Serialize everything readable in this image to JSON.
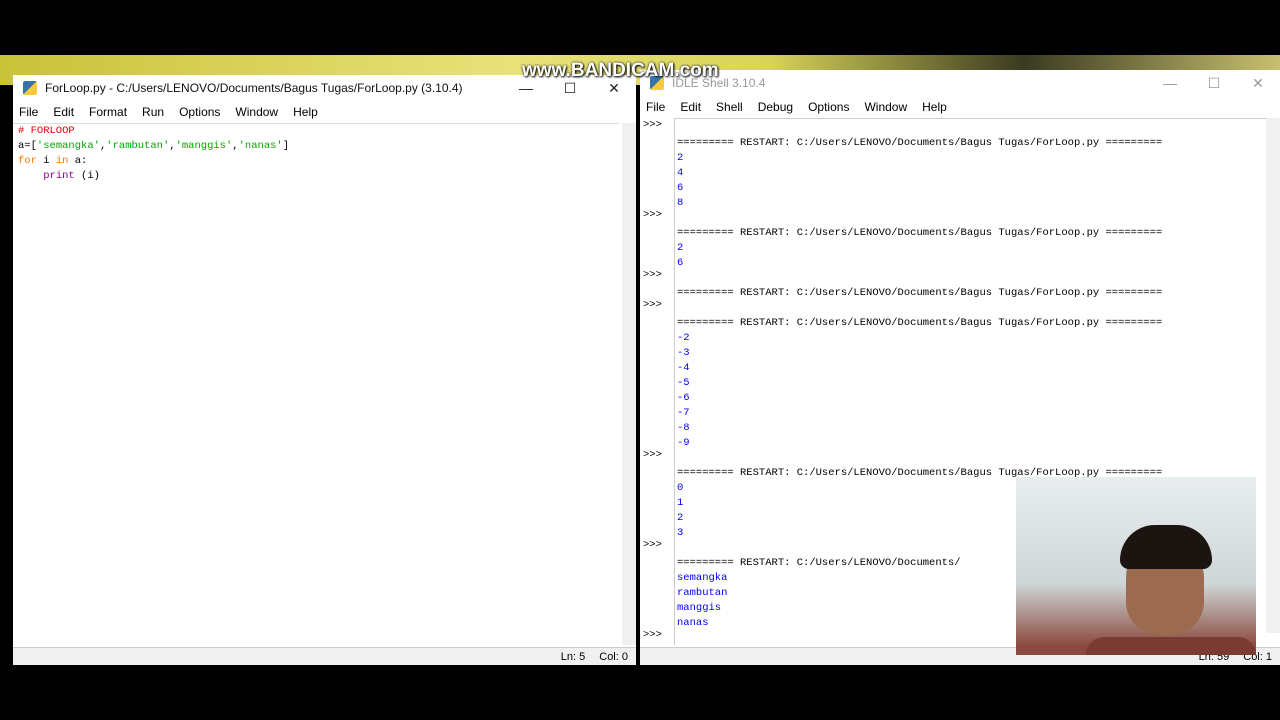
{
  "watermark": "www.BANDICAM.com",
  "editor": {
    "title": "ForLoop.py - C:/Users/LENOVO/Documents/Bagus Tugas/ForLoop.py (3.10.4)",
    "menu": [
      "File",
      "Edit",
      "Format",
      "Run",
      "Options",
      "Window",
      "Help"
    ],
    "code": {
      "comment": "# FORLOOP",
      "assign": "a=",
      "lb": "[",
      "s1": "'semangka'",
      "s2": "'rambutan'",
      "s3": "'manggis'",
      "s4": "'nanas'",
      "comma": ",",
      "rb": "]",
      "for": "for",
      "var": " i ",
      "in": "in",
      "target": " a:",
      "indent": "    ",
      "print": "print",
      "args": " (i)"
    },
    "status": {
      "ln": "Ln: 5",
      "col": "Col: 0"
    }
  },
  "shell": {
    "title": "IDLE Shell 3.10.4",
    "menu": [
      "File",
      "Edit",
      "Shell",
      "Debug",
      "Options",
      "Window",
      "Help"
    ],
    "restart": "========= RESTART: C:/Users/LENOVO/Documents/Bagus Tugas/ForLoop.py =========",
    "restart_partial": "========= RESTART: C:/Users/LENOVO/Documents/",
    "prompt": ">>>",
    "runs": [
      [
        "2",
        "4",
        "6",
        "8"
      ],
      [
        "2",
        "6"
      ],
      [],
      [
        "-2",
        "-3",
        "-4",
        "-5",
        "-6",
        "-7",
        "-8",
        "-9"
      ],
      [
        "0",
        "1",
        "2",
        "3"
      ],
      [
        "semangka",
        "rambutan",
        "manggis",
        "nanas"
      ]
    ],
    "status": {
      "ln": "Ln: 59",
      "col": "Col: 1"
    }
  },
  "window_controls": {
    "minimize": "—",
    "maximize": "☐",
    "close": "✕"
  }
}
